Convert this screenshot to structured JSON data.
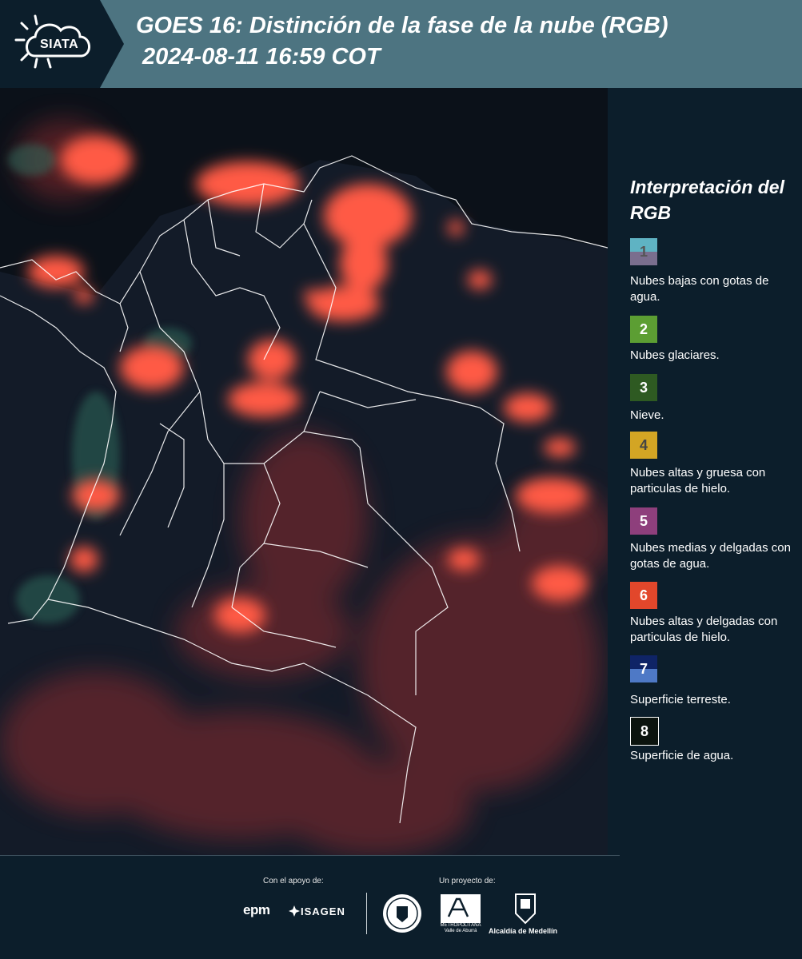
{
  "header": {
    "logo_text": "SIATA",
    "title_line1": "GOES 16: Distinción de la fase de la nube (RGB)",
    "title_line2": "2024-08-11 16:59 COT",
    "bg_color": "#4d7481"
  },
  "map": {
    "imagery": "false-color cloud phase satellite composite",
    "boundary_color": "#ffffff",
    "cloud_color": "#ff5a44",
    "background_color": "#0b1119"
  },
  "legend": {
    "title": "Interpretación del RGB",
    "items": [
      {
        "number": "1",
        "label": "Nubes bajas con gotas de agua.",
        "color_top": "#5fb3c3",
        "color_bottom": "#7a6e8e",
        "number_color": "#555555"
      },
      {
        "number": "2",
        "label": "Nubes glaciares.",
        "color_top": "#5c9e33",
        "color_bottom": "#5c9e33",
        "number_color": "#ffffff"
      },
      {
        "number": "3",
        "label": "Nieve.",
        "color_top": "#2e5a22",
        "color_bottom": "#2e5a22",
        "number_color": "#ffffff"
      },
      {
        "number": "4",
        "label": "Nubes altas y gruesa con particulas de hielo.",
        "color_top": "#d3a524",
        "color_bottom": "#d3a524",
        "number_color": "#444444"
      },
      {
        "number": "5",
        "label": "Nubes medias y delgadas con gotas de agua.",
        "color_top": "#8e3f7c",
        "color_bottom": "#8e3f7c",
        "number_color": "#ffffff"
      },
      {
        "number": "6",
        "label": "Nubes altas y delgadas con particulas de hielo.",
        "color_top": "#e2472b",
        "color_bottom": "#e2472b",
        "number_color": "#ffffff"
      },
      {
        "number": "7",
        "label": "Superficie terreste.",
        "color_top": "#0f2466",
        "color_bottom": "#4e79c6",
        "number_color": "#ffffff"
      },
      {
        "number": "8",
        "label": "Superficie de agua.",
        "color_top": "#0b130e",
        "color_bottom": "#0b130e",
        "number_color": "#ffffff"
      }
    ]
  },
  "footer": {
    "support_label": "Con el apoyo de:",
    "project_label": "Un proyecto de:",
    "sponsor1": "epm",
    "sponsor2": "ISAGEN",
    "partner1_text": "METROPOLITANA Valle de Aburrá",
    "partner2_text": "Alcaldía de Medellín"
  }
}
